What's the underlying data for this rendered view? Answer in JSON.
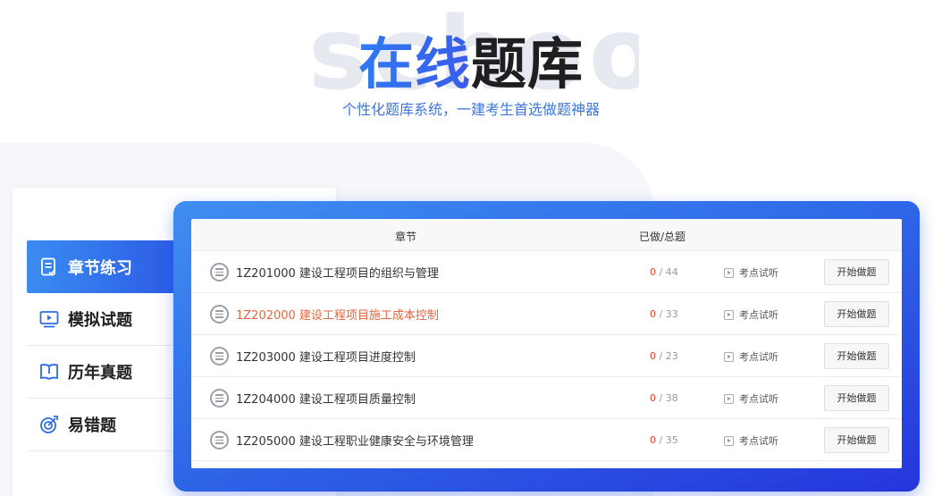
{
  "header": {
    "watermark": "school",
    "title_highlight": "在线",
    "title_rest": "题库",
    "subtitle": "个性化题库系统，一建考生首选做题神器"
  },
  "sidebar": {
    "items": [
      {
        "label": "章节练习",
        "icon": "checklist-icon",
        "active": true
      },
      {
        "label": "模拟试题",
        "icon": "video-play-icon",
        "active": false
      },
      {
        "label": "历年真题",
        "icon": "open-book-icon",
        "active": false
      },
      {
        "label": "易错题",
        "icon": "target-icon",
        "active": false
      }
    ]
  },
  "table": {
    "headers": {
      "chapter": "章节",
      "progress": "已做/总题"
    },
    "listen_label": "考点试听",
    "start_label": "开始做题",
    "rows": [
      {
        "title": "1Z201000 建设工程项目的组织与管理",
        "done": "0",
        "total": "/ 44",
        "highlighted": false
      },
      {
        "title": "1Z202000 建设工程项目施工成本控制",
        "done": "0",
        "total": "/ 33",
        "highlighted": true
      },
      {
        "title": "1Z203000 建设工程项目进度控制",
        "done": "0",
        "total": "/ 23",
        "highlighted": false
      },
      {
        "title": "1Z204000 建设工程项目质量控制",
        "done": "0",
        "total": "/ 38",
        "highlighted": false
      },
      {
        "title": "1Z205000 建设工程职业健康安全与环境管理",
        "done": "0",
        "total": "/ 35",
        "highlighted": false
      }
    ]
  },
  "colors": {
    "accent": "#2f6ae8",
    "highlight_row_text": "#e2663f",
    "done_count": "#e33d2b",
    "subtitle": "#3d76d8"
  }
}
